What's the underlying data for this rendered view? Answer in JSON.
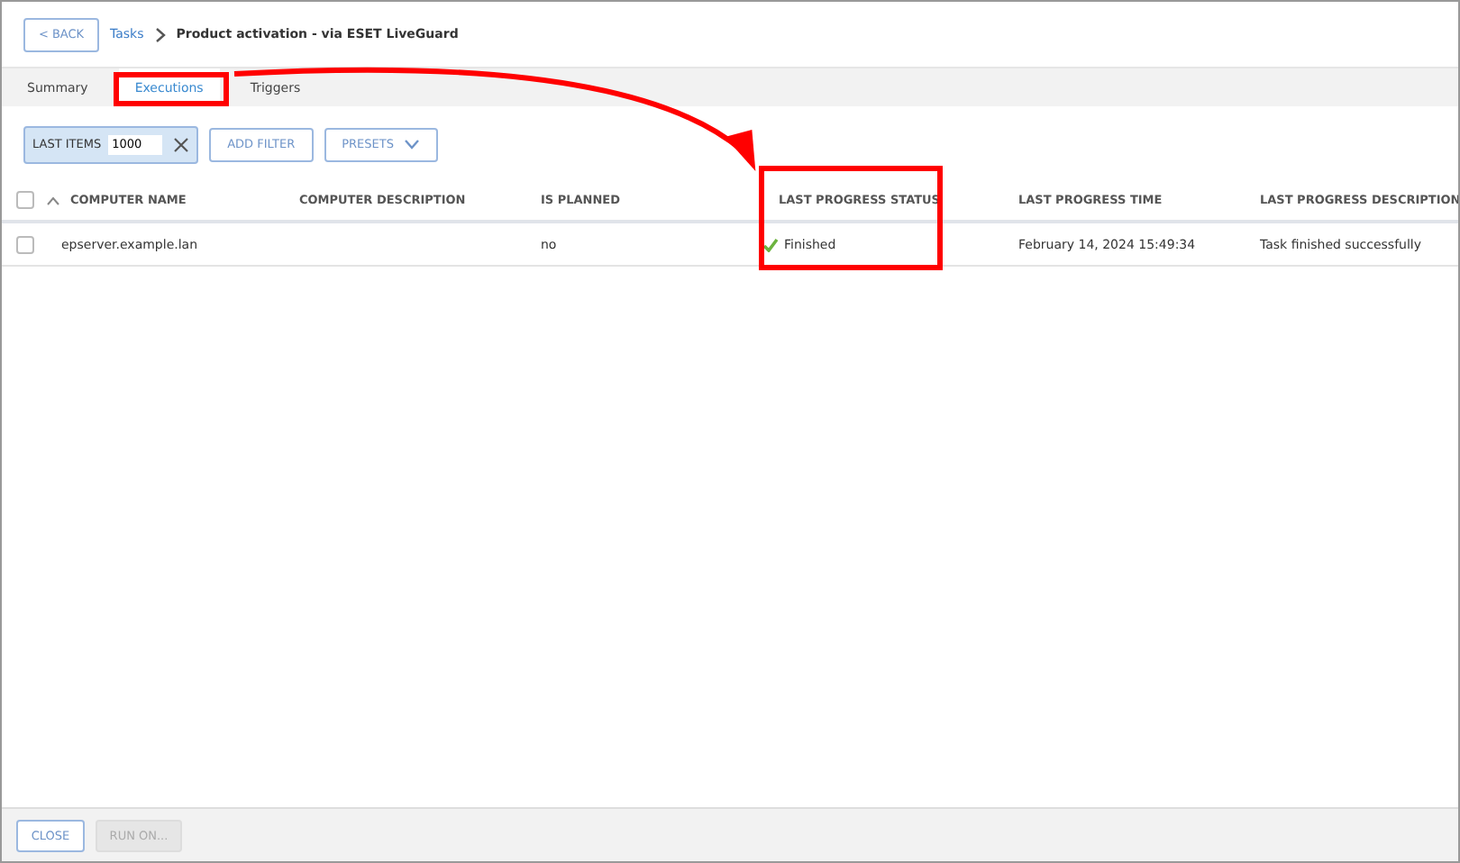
{
  "header": {
    "back_button": "< BACK",
    "breadcrumb": "Tasks",
    "title": "Product activation - via ESET LiveGuard"
  },
  "tabs": [
    {
      "label": "Summary",
      "selected": false,
      "highlighted": false
    },
    {
      "label": "Executions",
      "selected": true,
      "highlighted": true
    },
    {
      "label": "Triggers",
      "selected": false,
      "highlighted": false
    }
  ],
  "filter_bar": {
    "chip": {
      "label": "LAST ITEMS",
      "value": "1000"
    },
    "buttons": [
      {
        "label": "ADD FILTER",
        "kind": "plain"
      },
      {
        "label": "PRESETS",
        "kind": "dropdown"
      }
    ]
  },
  "table": {
    "select_all": {
      "checked": false
    },
    "columns": [
      {
        "label": "COMPUTER NAME",
        "sorted": true,
        "highlighted": false
      },
      {
        "label": "COMPUTER DESCRIPTION",
        "sorted": false,
        "highlighted": false
      },
      {
        "label": "IS PLANNED",
        "sorted": false,
        "highlighted": false
      },
      {
        "label": "LAST PROGRESS STATUS",
        "sorted": false,
        "highlighted": true
      },
      {
        "label": "LAST PROGRESS TIME",
        "sorted": false,
        "highlighted": false
      },
      {
        "label": "LAST PROGRESS DESCRIPTION",
        "sorted": false,
        "highlighted": false
      }
    ],
    "rows": [
      {
        "checked": false,
        "cells": [
          {
            "kind": "plain",
            "text": "epserver.example.lan"
          },
          {
            "kind": "plain"
          },
          {
            "kind": "plain",
            "text": "no"
          },
          {
            "kind": "success",
            "text": "Finished"
          },
          {
            "kind": "plain",
            "text": "February 14, 2024 15:49:34"
          },
          {
            "kind": "plain",
            "text": "Task finished successfully"
          }
        ]
      }
    ]
  },
  "footer": {
    "buttons": [
      {
        "label": "CLOSE",
        "disabled": false
      },
      {
        "label": "RUN ON...",
        "disabled": true
      }
    ]
  },
  "annotation_arrow": true
}
